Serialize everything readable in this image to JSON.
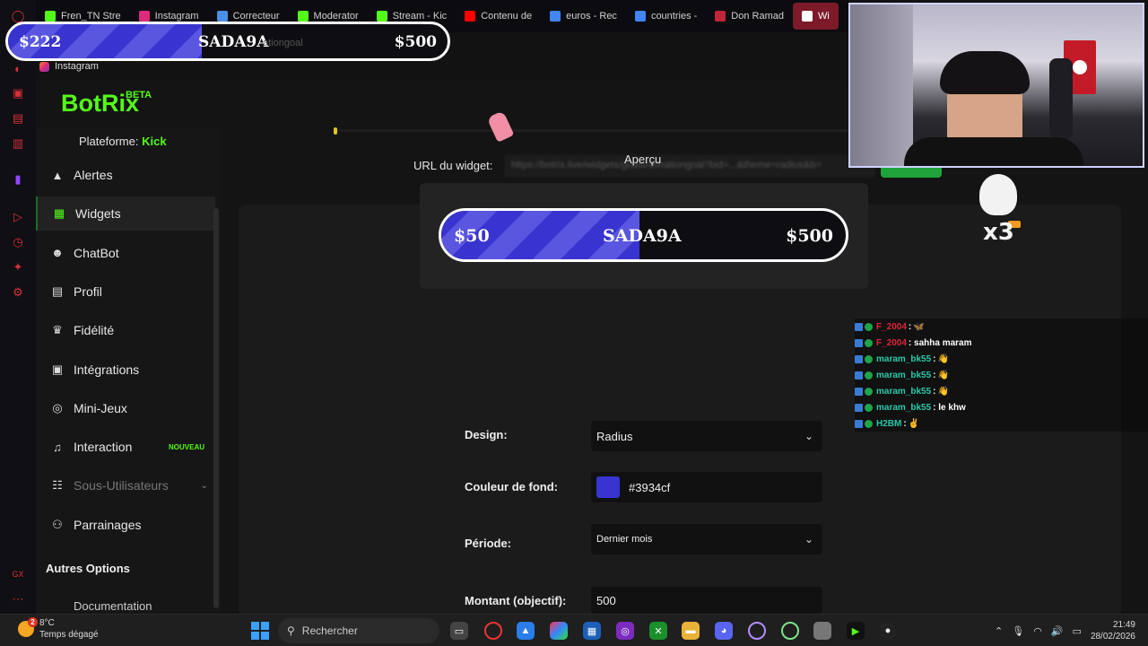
{
  "browser": {
    "tabs": [
      {
        "label": "Fren_TN Stre",
        "color": "#53fc18"
      },
      {
        "label": "Instagram",
        "color": "#dd2a7b"
      },
      {
        "label": "Correcteur",
        "color": "#4a8fe7"
      },
      {
        "label": "Moderator",
        "color": "#53fc18"
      },
      {
        "label": "Stream - Kic",
        "color": "#53fc18"
      },
      {
        "label": "Contenu de",
        "color": "#ff0000"
      },
      {
        "label": "euros - Rec",
        "color": "#4285f4"
      },
      {
        "label": "countries - ",
        "color": "#4285f4"
      },
      {
        "label": "Don Ramad",
        "color": "#c0263b"
      },
      {
        "label": "Wi",
        "color": "#ffffff",
        "active": true
      }
    ],
    "bookmark": "Instagram"
  },
  "goal_overlay_top": {
    "current": "$222",
    "name": "SADA9A",
    "target": "$500",
    "progress": 0.44,
    "ghost_text": "ationgoal"
  },
  "app": {
    "logo": "BotRix",
    "beta": "BETA",
    "platform_label": "Plateforme:",
    "platform_value": "Kick",
    "nav": [
      {
        "label": "Alertes",
        "icon": "warning-icon"
      },
      {
        "label": "Widgets",
        "icon": "grid-icon",
        "active": true
      },
      {
        "label": "ChatBot",
        "icon": "robot-icon"
      },
      {
        "label": "Profil",
        "icon": "id-card-icon"
      },
      {
        "label": "Fidélité",
        "icon": "trophy-icon"
      },
      {
        "label": "Intégrations",
        "icon": "chat-box-icon"
      },
      {
        "label": "Mini-Jeux",
        "icon": "gamepad-icon"
      },
      {
        "label": "Interaction",
        "icon": "music-icon",
        "badge": "NOUVEAU"
      },
      {
        "label": "Sous-Utilisateurs",
        "icon": "users-icon",
        "disabled": true
      },
      {
        "label": "Parrainages",
        "icon": "user-group-icon"
      }
    ],
    "section_other": "Autres Options",
    "doc_item": "Documentation",
    "url_label": "URL du widget:",
    "url_value": "https://botrix.live/widgets/goals/donationgoal?bid=...&theme=radius&b=",
    "preview_label": "Aperçu",
    "preview_goal": {
      "current": "$50",
      "name": "SADA9A",
      "target": "$500",
      "progress": 0.49
    },
    "form": {
      "design_label": "Design:",
      "design_value": "Radius",
      "bg_label": "Couleur de fond:",
      "bg_value": "#3934cf",
      "period_label": "Période:",
      "period_value": "Dernier mois",
      "amount_label": "Montant (objectif):",
      "amount_value": "500"
    }
  },
  "chat": [
    {
      "user": "F_2004",
      "color": "#e0243a",
      "msg": ":",
      "emote": "🦋"
    },
    {
      "user": "F_2004",
      "color": "#e0243a",
      "msg": ": sahha maram",
      "emote": ""
    },
    {
      "user": "maram_bk55",
      "color": "#29c9a8",
      "msg": ":",
      "emote": "👋"
    },
    {
      "user": "maram_bk55",
      "color": "#29c9a8",
      "msg": ":",
      "emote": "👋"
    },
    {
      "user": "maram_bk55",
      "color": "#29c9a8",
      "msg": ":",
      "emote": "👋"
    },
    {
      "user": "maram_bk55",
      "color": "#29c9a8",
      "msg": ": le khw",
      "emote": ""
    },
    {
      "user": "H2BM",
      "color": "#29c9a8",
      "msg": ":",
      "emote": "✌"
    }
  ],
  "mascot_text": "x3",
  "taskbar": {
    "weather_temp": "8°C",
    "weather_desc": "Temps dégagé",
    "weather_badge": "2",
    "search_placeholder": "Rechercher",
    "time": "21:49",
    "date": "28/02/2026"
  }
}
